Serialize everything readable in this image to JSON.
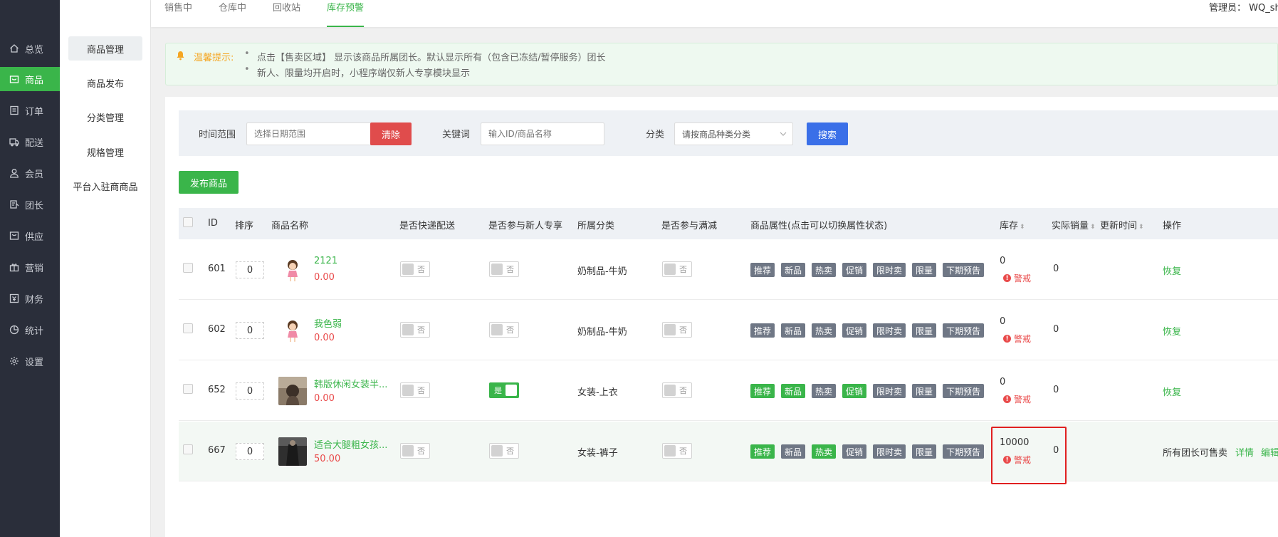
{
  "nav": {
    "items": [
      {
        "label": "总览",
        "icon": "home-icon"
      },
      {
        "label": "商品",
        "icon": "goods-icon",
        "active": true
      },
      {
        "label": "订单",
        "icon": "order-icon"
      },
      {
        "label": "配送",
        "icon": "delivery-icon"
      },
      {
        "label": "会员",
        "icon": "member-icon"
      },
      {
        "label": "团长",
        "icon": "leader-icon"
      },
      {
        "label": "供应",
        "icon": "supply-icon"
      },
      {
        "label": "营销",
        "icon": "gift-icon"
      },
      {
        "label": "财务",
        "icon": "finance-icon"
      },
      {
        "label": "统计",
        "icon": "pie-chart-icon"
      },
      {
        "label": "设置",
        "icon": "gear-icon"
      }
    ]
  },
  "subnav": {
    "items": [
      {
        "label": "商品管理",
        "active": true
      },
      {
        "label": "商品发布"
      },
      {
        "label": "分类管理"
      },
      {
        "label": "规格管理"
      },
      {
        "label": "平台入驻商商品"
      }
    ]
  },
  "tabs": [
    {
      "label": "销售中"
    },
    {
      "label": "仓库中"
    },
    {
      "label": "回收站"
    },
    {
      "label": "库存预警",
      "active": true
    }
  ],
  "admin": {
    "text": "管理员： WQ_sh"
  },
  "tip": {
    "title": "温馨提示:",
    "lines": [
      "点击【售卖区域】 显示该商品所属团长。默认显示所有（包含已冻结/暂停服务）团长",
      "新人、限量均开启时，小程序端仅新人专享模块显示"
    ]
  },
  "filter": {
    "time_label": "时间范围",
    "time_placeholder": "选择日期范围",
    "clear": "清除",
    "keyword_label": "关键词",
    "keyword_placeholder": "输入ID/商品名称",
    "category_label": "分类",
    "category_value": "请按商品种类分类",
    "search": "搜索"
  },
  "publish_button": "发布商品",
  "table": {
    "headers": {
      "id": "ID",
      "sort": "排序",
      "name": "商品名称",
      "express": "是否快递配送",
      "newcomer": "是否参与新人专享",
      "category": "所属分类",
      "fullcut": "是否参与满减",
      "attrs": "商品属性(点击可以切换属性状态)",
      "stock": "库存",
      "sales": "实际销量",
      "updated": "更新时间",
      "ops": "操作"
    },
    "toggle_off": "否",
    "toggle_on": "是",
    "attr_labels": [
      "推荐",
      "新品",
      "热卖",
      "促销",
      "限时卖",
      "限量",
      "下期预告"
    ],
    "warn_label": "警戒",
    "rows": [
      {
        "id": "601",
        "sort": "0",
        "name": "2121",
        "price": "0.00",
        "express": false,
        "newcomer": false,
        "category": "奶制品-牛奶",
        "fullcut": false,
        "attrs_on": [
          false,
          false,
          false,
          false,
          false,
          false,
          false
        ],
        "stock": "0",
        "sales": "0",
        "ops": [
          "恢复"
        ]
      },
      {
        "id": "602",
        "sort": "0",
        "name": "我色弱",
        "price": "0.00",
        "express": false,
        "newcomer": false,
        "category": "奶制品-牛奶",
        "fullcut": false,
        "attrs_on": [
          false,
          false,
          false,
          false,
          false,
          false,
          false
        ],
        "stock": "0",
        "sales": "0",
        "ops": [
          "恢复"
        ]
      },
      {
        "id": "652",
        "sort": "0",
        "name": "韩版休闲女装半...",
        "price": "0.00",
        "express": false,
        "newcomer": true,
        "category": "女装-上衣",
        "fullcut": false,
        "attrs_on": [
          true,
          true,
          false,
          true,
          false,
          false,
          false
        ],
        "stock": "0",
        "sales": "0",
        "ops": [
          "恢复"
        ]
      },
      {
        "id": "667",
        "sort": "0",
        "name": "适合大腿粗女孩...",
        "price": "50.00",
        "express": false,
        "newcomer": false,
        "category": "女装-裤子",
        "fullcut": false,
        "attrs_on": [
          true,
          false,
          true,
          false,
          false,
          false,
          false
        ],
        "stock": "10000",
        "sales": "0",
        "ops": [
          "所有团长可售卖",
          "详情",
          "编辑"
        ]
      }
    ]
  },
  "colors": {
    "accent": "#3ab54a",
    "danger": "#e94a4a",
    "primary": "#3a6fe8",
    "sidebar": "#2a2e3a"
  }
}
